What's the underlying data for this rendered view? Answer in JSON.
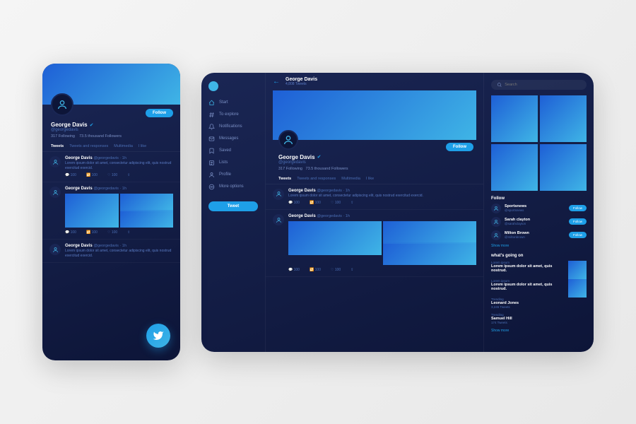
{
  "profile": {
    "name": "George Davis",
    "handle": "@georgedavis",
    "following": "317",
    "followingLabel": "Following",
    "followers": "73.5 thousand",
    "followersLabel": "Followers",
    "tweetCount": "4,808 Tweets",
    "followBtn": "Follow"
  },
  "tabs": [
    "Tweets",
    "Tweets and responses",
    "Multimedia",
    "I like"
  ],
  "tweetAuthor": "George Davis",
  "tweetHandle": "@georgedavis · 1h",
  "tweetBody": "Lorem ipsum dolor sit amet, consectetur adipiscing elit, quis nostrud exercitud exercid.",
  "actions": {
    "reply": "100",
    "retweet": "100",
    "like": "100"
  },
  "sidebar": {
    "items": [
      "Start",
      "To explore",
      "Notifications",
      "Messages",
      "Saved",
      "Lists",
      "Profile",
      "More options"
    ],
    "tweet": "Tweet"
  },
  "search": {
    "placeholder": "Search"
  },
  "followPanel": {
    "title": "Follow",
    "items": [
      {
        "name": "Sportsnews",
        "handle": "@sportsnews"
      },
      {
        "name": "Sarah clayton",
        "handle": "@sarahclayton"
      },
      {
        "name": "Milton Brown",
        "handle": "@miltonbrown"
      }
    ],
    "btn": "Follow",
    "more": "Show more"
  },
  "trends": {
    "title": "what's going on",
    "items": [
      {
        "cat": "Lorem ipsum",
        "title": "Lorem ipsum dolor sit amet, quis nostrud."
      },
      {
        "cat": "Lorem ipsum",
        "title": "Lorem ipsum dolor sit amet, quis nostrud."
      },
      {
        "cat": "Trending",
        "title": "Leonard Jones",
        "count": "3,245 Tweets"
      },
      {
        "cat": "Trending",
        "title": "Samuel Hill",
        "count": "174 Tweets"
      }
    ],
    "more": "Show more"
  }
}
